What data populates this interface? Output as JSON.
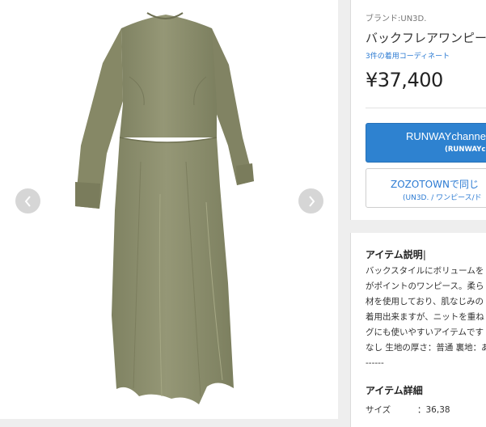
{
  "gallery": {
    "image_alt": "khaki long dress",
    "prev_icon": "chevron-left-icon",
    "next_icon": "chevron-right-icon"
  },
  "product": {
    "brand": "ブランド:UN3D.",
    "name": "バックフレアワンピース",
    "coordinate_link": "3件の着用コーディネート",
    "price": "¥37,400"
  },
  "buttons": {
    "runway_main": "RUNWAYchannel",
    "runway_sub": "(RUNWAYch",
    "zozo_main": "ZOZOTOWNで同じ",
    "zozo_sub": "(UN3D. / ワンピース/ド"
  },
  "description": {
    "title": "アイテム説明",
    "lines": [
      "バックスタイルにボリュームを",
      "がポイントのワンピース。柔ら",
      "材を使用しており、肌なじみの",
      "着用出来ますが、ニットを重ね",
      "グにも使いやすいアイテムです",
      "なし 生地の厚さ：普通 裏地：あ",
      "------"
    ]
  },
  "details": {
    "title": "アイテム詳細",
    "size_label": "サイズ",
    "size_value": "：36,38"
  },
  "colors": {
    "accent": "#2e82d0",
    "link": "#2c7bd3",
    "dress": "#8d8f6e"
  }
}
